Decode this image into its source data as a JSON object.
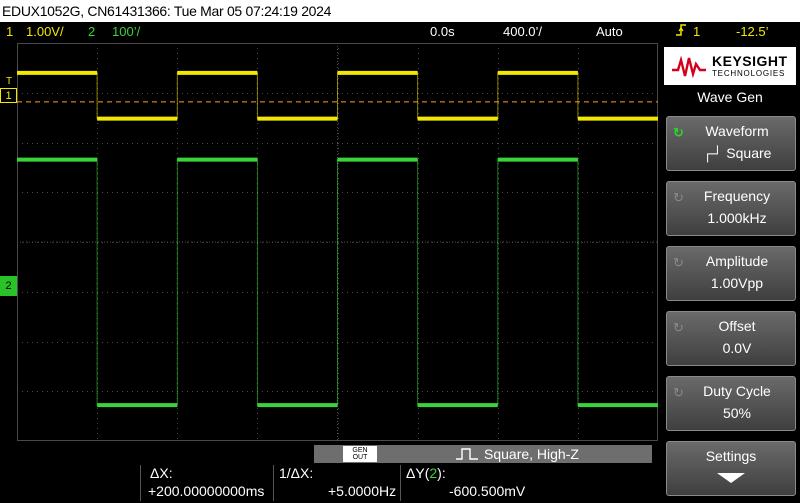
{
  "title": "EDUX1052G, CN61431366: Tue Mar 05 07:24:19 2024",
  "status": {
    "ch1_num": "1",
    "ch1_scale": "1.00V/",
    "ch2_num": "2",
    "ch2_scale": "100’/",
    "time_delay": "0.0s",
    "time_scale": "400.0’/",
    "trigger_mode": "Auto",
    "trigger_icon": "rising-edge-icon",
    "trigger_source": "1",
    "trigger_level": "-12.5’"
  },
  "markers": {
    "trigger": "T",
    "ch1": "1",
    "ch2": "2"
  },
  "colors": {
    "ch1": "#f4e800",
    "ch2": "#3ad43a",
    "trigger_line": "#ff9c1a",
    "grid": "#4a4a4a"
  },
  "waveforms": {
    "period_fraction_of_screen": 0.25,
    "duty_cycle": 0.5,
    "ch1": {
      "high_level_fraction": 0.075,
      "low_level_fraction": 0.19
    },
    "ch2": {
      "high_level_fraction": 0.293,
      "low_level_fraction": 0.91
    },
    "trigger_level_fraction": 0.148
  },
  "panel": {
    "brand_name": "KEYSIGHT",
    "brand_sub": "TECHNOLOGIES",
    "heading": "Wave Gen",
    "softkeys": [
      {
        "label": "Waveform",
        "value": "┌┘ Square",
        "active": true
      },
      {
        "label": "Frequency",
        "value": "1.000kHz",
        "active": false
      },
      {
        "label": "Amplitude",
        "value": "1.00Vpp",
        "active": false
      },
      {
        "label": "Offset",
        "value": "0.0V",
        "active": false
      },
      {
        "label": "Duty Cycle",
        "value": "50%",
        "active": false
      }
    ],
    "settings_label": "Settings"
  },
  "wavegen_info": {
    "badge_top": "GEN",
    "badge_bottom": "OUT",
    "text": "Square, High-Z"
  },
  "measurements": {
    "dx_label": "ΔX:",
    "dx_value": "+200.00000000ms",
    "inv_dx_label": "1/ΔX:",
    "inv_dx_value": "+5.0000Hz",
    "dy_label": "ΔY(",
    "dy_channel": "2",
    "dy_label_end": "):",
    "dy_value": "-600.500mV"
  }
}
